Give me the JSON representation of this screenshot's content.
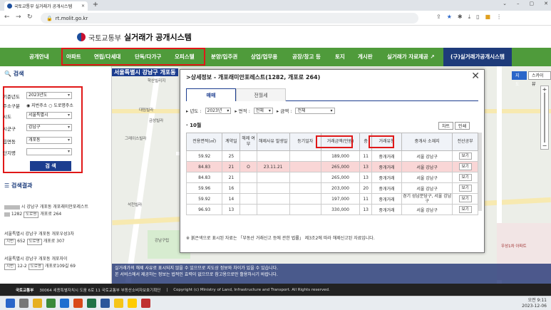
{
  "browser": {
    "tab_title": "국토교통부 실거래가 공개시스템",
    "url": "rt.molit.go.kr",
    "new_tab": "+"
  },
  "site": {
    "ministry": "국토교통부",
    "name": "실거래가 공개시스템"
  },
  "nav": [
    "공개안내",
    "아파트",
    "연립/다세대",
    "단독/다가구",
    "오피스텔",
    "분양/입주권",
    "상업/업무용",
    "공장/창고 등",
    "토지",
    "게시판",
    "실거래가 자료제공 ↗",
    "(구)실거래가공개시스템"
  ],
  "search": {
    "title": "검색",
    "year_label": "기준년도",
    "year": "2023년도",
    "addr_label": "주소구분",
    "addr_opt1": "지번주소",
    "addr_opt2": "도로명주소",
    "sido_label": "시도",
    "sido": "서울특별시",
    "sigungu_label": "시군구",
    "sigungu": "강남구",
    "dong_label": "읍면동",
    "dong": "개포동",
    "danji_label": "단지명",
    "button": "검 색"
  },
  "results": {
    "title": "검색결과",
    "items": [
      {
        "line1": "시 강남구 개포동 개포래미안포레스트",
        "jibun": "1282",
        "road_tag": "도로명",
        "road": "개포로 264"
      },
      {
        "line1": "서울특별시 강남구 개포동 개포우성3차",
        "jibun_tag": "지번",
        "jibun": "652",
        "road_tag": "도로명",
        "road": "개포로 307"
      },
      {
        "line1": "서울특별시 강남구 개포동 개포자이",
        "jibun_tag": "지번",
        "jibun": "12-2",
        "road_tag": "도로명",
        "road": "개포로109길 69"
      }
    ]
  },
  "map": {
    "header": "서울특별시 강남구 개포동",
    "btn_map": "지도",
    "btn_sky": "스카이뷰",
    "labels": [
      "학산빌리지",
      "대림빌라",
      "금성빌라",
      "그레이스빌라",
      "석천빌라",
      "강남구립",
      "우성1차 아파트"
    ]
  },
  "modal": {
    "title": ">상세정보 - 개포래미안포레스트(1282, 개포로 264)",
    "close": "✕",
    "tab1": "매매",
    "tab2": "전월세",
    "filter_year_label": "▸ 년도 :",
    "filter_year": "2023년",
    "filter_area_label": "▸ 면적 :",
    "filter_area": "전체",
    "filter_price_label": "▸ 금액 :",
    "filter_price": "전체",
    "month": "· 10월",
    "btn_chart": "차트",
    "btn_print": "인쇄",
    "headers": [
      "전용면적(㎡)",
      "계약일",
      "해제 여부",
      "해제사유 발생일",
      "등기일자",
      "거래금액(만원)",
      "층",
      "거래유형",
      "중개사 소재지",
      "전산공부"
    ],
    "rows": [
      {
        "area": "59.92",
        "day": "25",
        "cancel": "",
        "cancel_date": "",
        "reg": "",
        "price": "189,000",
        "floor": "11",
        "type": "중개거래",
        "agent": "서울 강남구",
        "doc": "보기"
      },
      {
        "area": "84.83",
        "day": "21",
        "cancel": "O",
        "cancel_date": "23.11.21",
        "reg": "",
        "price": "265,000",
        "floor": "13",
        "type": "중개거래",
        "agent": "서울 강남구",
        "doc": "보기"
      },
      {
        "area": "84.83",
        "day": "21",
        "cancel": "",
        "cancel_date": "",
        "reg": "",
        "price": "265,000",
        "floor": "13",
        "type": "중개거래",
        "agent": "서울 강남구",
        "doc": "보기"
      },
      {
        "area": "59.96",
        "day": "16",
        "cancel": "",
        "cancel_date": "",
        "reg": "",
        "price": "203,000",
        "floor": "20",
        "type": "중개거래",
        "agent": "서울 강남구",
        "doc": "보기"
      },
      {
        "area": "59.92",
        "day": "14",
        "cancel": "",
        "cancel_date": "",
        "reg": "",
        "price": "197,000",
        "floor": "11",
        "type": "중개거래",
        "agent": "경기 성남분당구, 서울 강남구",
        "doc": "보기"
      },
      {
        "area": "96.93",
        "day": "13",
        "cancel": "",
        "cancel_date": "",
        "reg": "",
        "price": "330,000",
        "floor": "13",
        "type": "중개거래",
        "agent": "서울 강남구",
        "doc": "보기"
      }
    ],
    "footnote": "※ 붉은색으로 표시된 자료는 「부동산 거래신고 등에 관한 법률」 제3조2에 따라 해제신고된 자료입니다."
  },
  "disclaimer": [
    "본 서비스에서 제공하는 정보는 법적인 효력이 없으므로 참고용으로만 활용하시기 바랍니다.",
    "실거래가의 해제 사유로 표시되지 않을 수 있으므로 지도상 정보와 차이가 있을 수 있습니다."
  ],
  "footer": {
    "address": "30064 세종특별자치시 도움 6로 11 국토교통부 부동산소비자보호기획단",
    "copyright": "Copyright (c) Ministry of Land, Infrastructure and Transport. All Rights reserved."
  },
  "taskbar": {
    "time": "오전 9:11",
    "date": "2023-12-06"
  }
}
